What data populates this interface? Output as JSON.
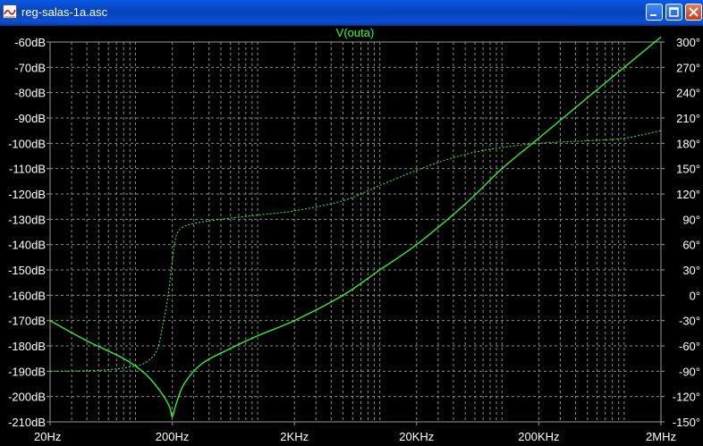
{
  "window": {
    "title": "reg-salas-1a.asc",
    "icons": {
      "app": "waveform-app-icon",
      "min": "minimize-icon",
      "max": "maximize-icon",
      "close": "close-icon"
    }
  },
  "chart_data": {
    "type": "line",
    "title": "V(outa)",
    "x_scale": "log",
    "xlim": [
      20,
      2000000
    ],
    "x_ticks": [
      {
        "value": 20,
        "label": "20Hz"
      },
      {
        "value": 200,
        "label": "200Hz"
      },
      {
        "value": 2000,
        "label": "2KHz"
      },
      {
        "value": 20000,
        "label": "20KHz"
      },
      {
        "value": 200000,
        "label": "200KHz"
      },
      {
        "value": 2000000,
        "label": "2MHz"
      }
    ],
    "ylim": [
      -210,
      -60
    ],
    "y_ticks": [
      {
        "value": -60,
        "label": "-60dB"
      },
      {
        "value": -70,
        "label": "-70dB"
      },
      {
        "value": -80,
        "label": "-80dB"
      },
      {
        "value": -90,
        "label": "-90dB"
      },
      {
        "value": -100,
        "label": "-100dB"
      },
      {
        "value": -110,
        "label": "-110dB"
      },
      {
        "value": -120,
        "label": "-120dB"
      },
      {
        "value": -130,
        "label": "-130dB"
      },
      {
        "value": -140,
        "label": "-140dB"
      },
      {
        "value": -150,
        "label": "-150dB"
      },
      {
        "value": -160,
        "label": "-160dB"
      },
      {
        "value": -170,
        "label": "-170dB"
      },
      {
        "value": -180,
        "label": "-180dB"
      },
      {
        "value": -190,
        "label": "-190dB"
      },
      {
        "value": -200,
        "label": "-200dB"
      },
      {
        "value": -210,
        "label": "-210dB"
      }
    ],
    "y2lim": [
      -150,
      300
    ],
    "y2_ticks": [
      {
        "value": 300,
        "label": "300°"
      },
      {
        "value": 270,
        "label": "270°"
      },
      {
        "value": 240,
        "label": "240°"
      },
      {
        "value": 210,
        "label": "210°"
      },
      {
        "value": 180,
        "label": "180°"
      },
      {
        "value": 150,
        "label": "150°"
      },
      {
        "value": 120,
        "label": "120°"
      },
      {
        "value": 90,
        "label": "90°"
      },
      {
        "value": 60,
        "label": "60°"
      },
      {
        "value": 30,
        "label": "30°"
      },
      {
        "value": 0,
        "label": "0°"
      },
      {
        "value": -30,
        "label": "-30°"
      },
      {
        "value": -60,
        "label": "-60°"
      },
      {
        "value": -90,
        "label": "-90°"
      },
      {
        "value": -120,
        "label": "-120°"
      },
      {
        "value": -150,
        "label": "-150°"
      }
    ],
    "grid": true,
    "series": [
      {
        "name": "V(outa)",
        "style": "solid",
        "axis": "left",
        "color": "#33ff33",
        "x": [
          20,
          40,
          80,
          120,
          160,
          190,
          200,
          215,
          250,
          350,
          600,
          1000,
          2000,
          5000,
          10000,
          20000,
          50000,
          100000,
          200000,
          500000,
          1000000,
          2000000
        ],
        "y": [
          -170,
          -178,
          -185,
          -191,
          -198,
          -204,
          -208,
          -203,
          -195,
          -187,
          -181,
          -176,
          -170,
          -160,
          -150,
          -140,
          -124,
          -110,
          -98,
          -82,
          -70,
          -58
        ]
      },
      {
        "style": "dashed",
        "axis": "right",
        "color": "#33ff33",
        "x": [
          20,
          50,
          90,
          120,
          150,
          170,
          185,
          200,
          215,
          240,
          300,
          500,
          1000,
          2000,
          5000,
          10000,
          20000,
          40000,
          80000,
          200000,
          500000,
          1000000,
          2000000
        ],
        "y": [
          -90,
          -89,
          -85,
          -80,
          -65,
          -30,
          0,
          40,
          70,
          80,
          85,
          90,
          95,
          100,
          112,
          130,
          148,
          163,
          173,
          180,
          183,
          186,
          195
        ]
      }
    ]
  }
}
